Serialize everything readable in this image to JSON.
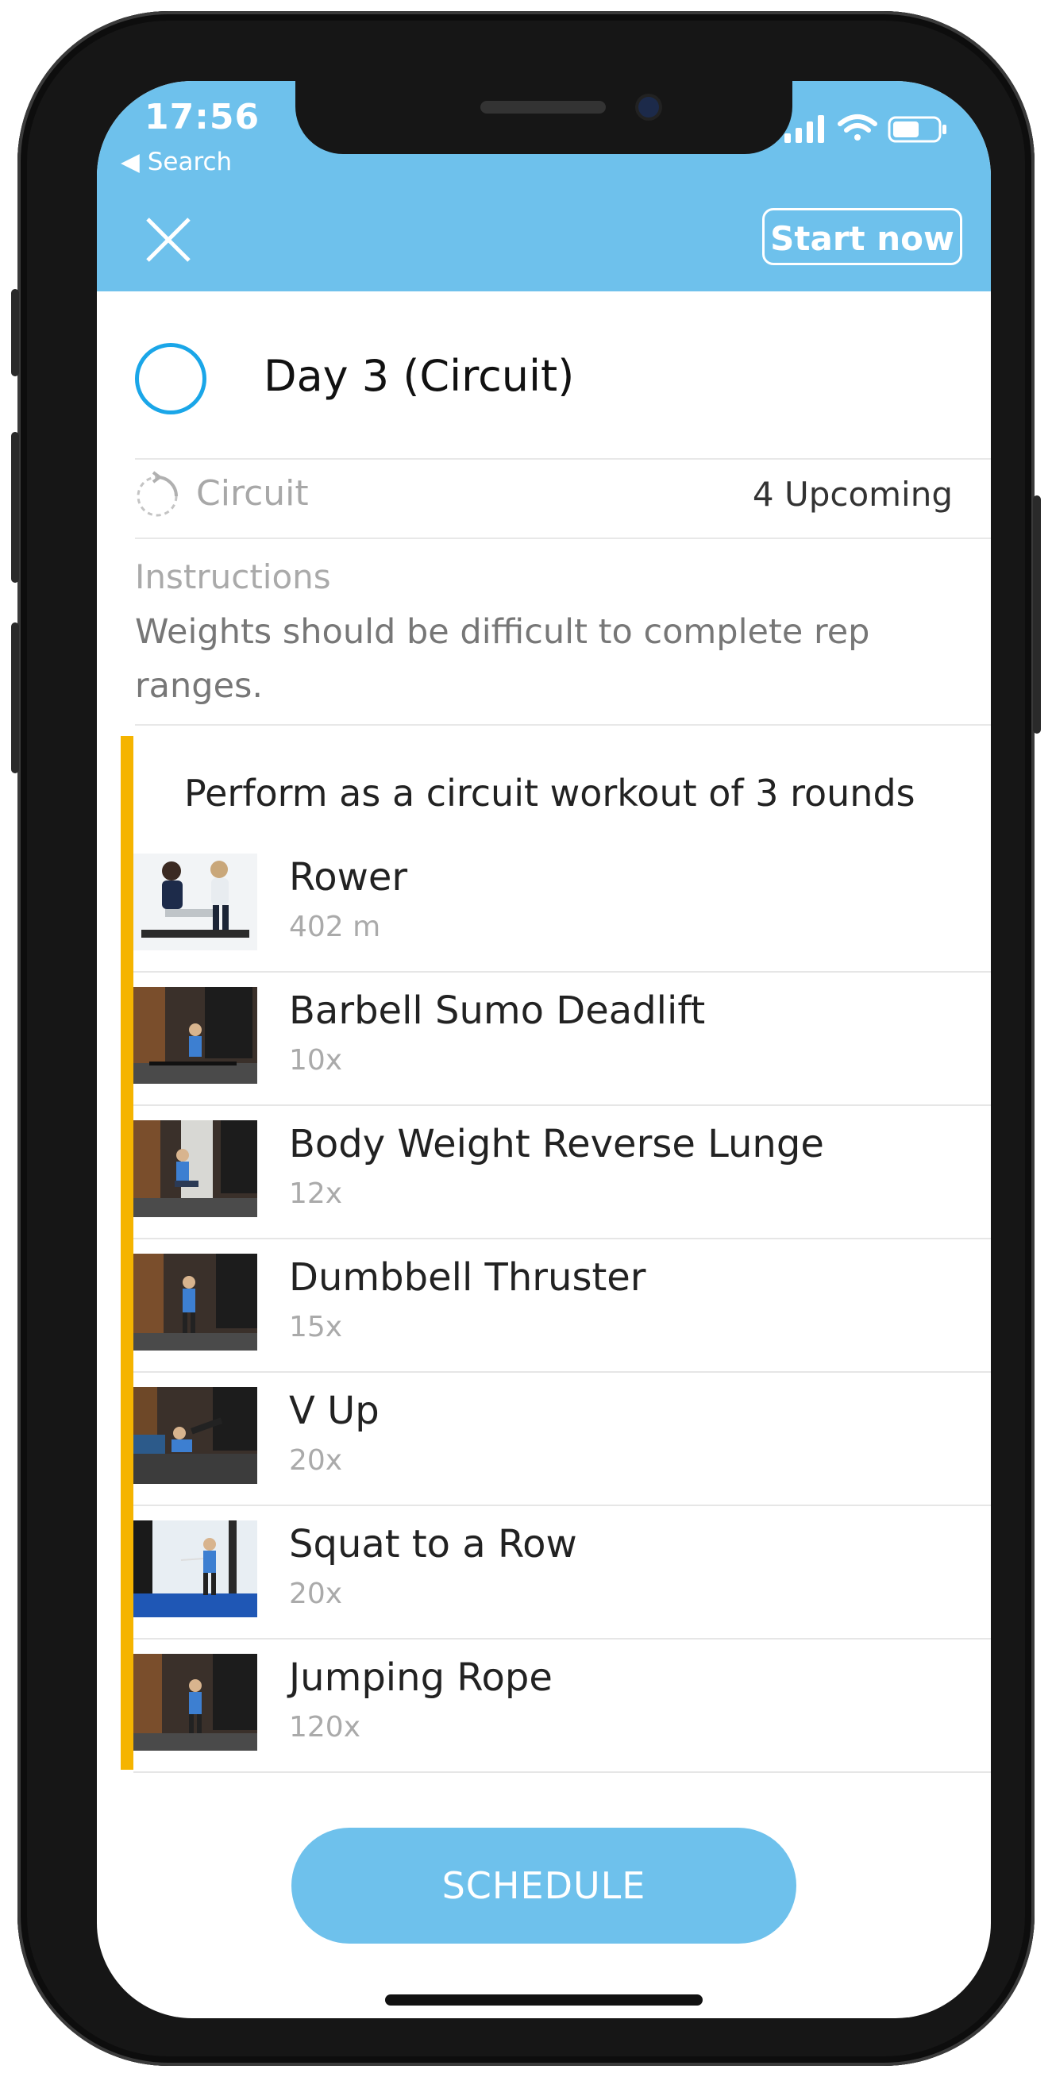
{
  "status": {
    "time": "17:56",
    "back_label": "◀ Search"
  },
  "toolbar": {
    "start_label": "Start now"
  },
  "workout": {
    "title": "Day 3 (Circuit)",
    "type_label": "Circuit",
    "upcoming": "4 Upcoming",
    "instructions_label": "Instructions",
    "instructions_text": "Weights should be difficult to complete rep ranges."
  },
  "circuit": {
    "title": "Perform as a circuit workout of 3 rounds",
    "exercises": [
      {
        "name": "Rower",
        "detail": "402 m"
      },
      {
        "name": "Barbell Sumo Deadlift",
        "detail": "10x"
      },
      {
        "name": "Body Weight Reverse Lunge",
        "detail": "12x"
      },
      {
        "name": "Dumbbell Thruster",
        "detail": "15x"
      },
      {
        "name": "V Up",
        "detail": "20x"
      },
      {
        "name": "Squat to a Row",
        "detail": "20x"
      },
      {
        "name": "Jumping Rope",
        "detail": "120x"
      }
    ]
  },
  "footer": {
    "schedule_label": "SCHEDULE"
  },
  "colors": {
    "accent": "#6ec1ec",
    "circuit_bar": "#f5b400",
    "check_ring": "#1aa6e8"
  }
}
